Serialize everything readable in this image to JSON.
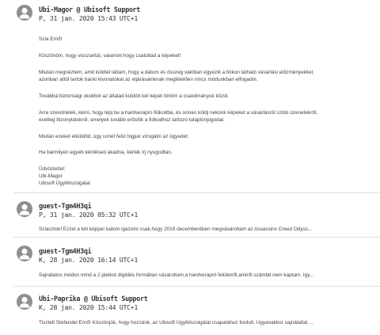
{
  "messages": [
    {
      "author": "Ubi-Magor @ Ubisoft Support",
      "date": "P, 31 jan. 2020 15:43 UTC+1",
      "paragraphs": [
        "Szia Ernő!",
        "Köszönöm, hogy visszaírtál, valamint hogy csatoltad a képeket!",
        "Miután megnéztem, amit küldtél láttam, hogy a dátum és összeg valóban egyezik a fiókon látható vásárlási előzményekkel, azonban attól tartok banki kivonatokat az eljárásainknak megfelelően nincs módunkban elfogadni.",
        "Továbbá biztonsági okokból az általad küldött két képet törlöm a csatolmányok közül.",
        "Arra szeretnélek, kérni, hogy lépj be a hardverapro fiókodba, és onnan küldj nekünk képeket a vásárlásról szóló üzenetekről, esetleg bizonylatokról, amelyek tovább erősítik a fiókodhoz tartozó tulajdonjogodat.",
        "Miután ezeket elküldöd, úgy ismét felül fogjuk vizsgálni az ügyedet.",
        "Ha bármilyen egyéb kérdésed akadna, kérlek írj nyugodtan.",
        "Üdvözlettel:",
        "Ubi-Magor",
        "Ubisoft Ügyfélszolgálat"
      ]
    },
    {
      "author": "guest-Tgm4H3qi",
      "date": "P, 31 jan. 2020 05:32 UTC+1",
      "snippet": "Sziasztok! Ezzel a két képpel tudom igazolni csak,hogy 2018 decemberében megvásároltam az Assassins Creed Odyss..."
    },
    {
      "author": "guest-Tgm4H3qi",
      "date": "K, 28 jan. 2020 16:14 UTC+1",
      "snippet": "Sajnálatos módon mind a 2 játékot digitális formában vásároltam,a hardverapró felületről,amiről számlát nem kaptam. Így..."
    },
    {
      "author": "Ubi-Paprika @ Ubisoft Support",
      "date": "K, 28 jan. 2020 15:44 UTC+1",
      "snippet": "Tisztelt Stefandel Ernő! Köszönjük, hogy hozzánk, az Ubisoft Ügyfélszolgálat csapatához fordult.  Ugyanakkor sajnálattal ..."
    }
  ],
  "icons": {
    "avatar": "user-avatar-icon"
  },
  "colors": {
    "avatar_bg": "#8e8e8e",
    "divider": "#dcdcdc",
    "text": "#333333"
  }
}
